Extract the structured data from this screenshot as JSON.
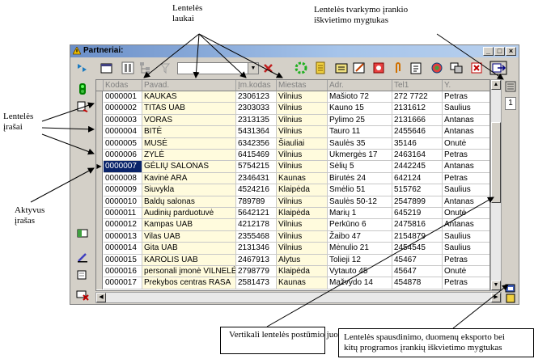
{
  "window": {
    "title": "Partneriai:",
    "min": "_",
    "max": "□",
    "close": "×"
  },
  "toolbar": {
    "combo_value": ""
  },
  "grid": {
    "columns": [
      "Kodas",
      "Pavad.",
      "Įm.kodas",
      "Miestas",
      "Adr.",
      "Tel1",
      "Y."
    ],
    "rows": [
      [
        "0000001",
        "KAUKAS",
        "2306123",
        "Vilnius",
        "Mašioto 72",
        "272 7722",
        "Petras"
      ],
      [
        "0000002",
        "TITAS UAB",
        "2303033",
        "Vilnius",
        "Kauno 15",
        "2131612",
        "Saulius"
      ],
      [
        "0000003",
        "VORAS",
        "2313135",
        "Vilnius",
        "Pylimo 25",
        "2131666",
        "Antanas"
      ],
      [
        "0000004",
        "BITĖ",
        "5431364",
        "Vilnius",
        "Tauro 11",
        "2455646",
        "Antanas"
      ],
      [
        "0000005",
        "MUSĖ",
        "6342356",
        "Šiauliai",
        "Saulės 35",
        "35146",
        "Onutė"
      ],
      [
        "0000006",
        "ZYLĖ",
        "6415469",
        "Vilnius",
        "Ukmergės 17",
        "2463164",
        "Petras"
      ],
      [
        "0000007",
        "GĖLIŲ SALONAS",
        "5754215",
        "Vilnius",
        "Sėlių 5",
        "2442245",
        "Antanas"
      ],
      [
        "0000008",
        "Kavinė ARA",
        "2346431",
        "Kaunas",
        "Birutės 24",
        "642124",
        "Petras"
      ],
      [
        "0000009",
        "Siuvykla",
        "4524216",
        "Klaipėda",
        "Smėlio 51",
        "515762",
        "Saulius"
      ],
      [
        "0000010",
        "Baldų salonas",
        "789789",
        "Vilnius",
        "Saulės 50-12",
        "2547899",
        "Antanas"
      ],
      [
        "0000011",
        "Audinių parduotuvė",
        "5642121",
        "Klaipėda",
        "Marių 1",
        "645219",
        "Onutė"
      ],
      [
        "0000012",
        "Kampas UAB",
        "4212178",
        "Vilnius",
        "Perkūno 6",
        "2475816",
        "Antanas"
      ],
      [
        "0000013",
        "Vilas UAB",
        "2355468",
        "Vilnius",
        "Žaibo 47",
        "2154879",
        "Saulius"
      ],
      [
        "0000014",
        "Gita UAB",
        "2131346",
        "Vilnius",
        "Mėnulio 21",
        "2454545",
        "Saulius"
      ],
      [
        "0000015",
        "KAROLIS UAB",
        "2467913",
        "Alytus",
        "Tolieji 12",
        "45467",
        "Petras"
      ],
      [
        "0000016",
        "personali įmonė VILNELĖ",
        "2798779",
        "Klaipėda",
        "Vytauto 45",
        "45647",
        "Onutė"
      ],
      [
        "0000017",
        "Prekybos centras RASA",
        "2581473",
        "Kaunas",
        "Mažvydo 14",
        "454878",
        "Petras"
      ]
    ],
    "active_row_index": 6
  },
  "right_panel": {
    "page": "1"
  },
  "annotations": {
    "fields": "Lentelės\nlaukai",
    "manager": "Lentelės tvarkymo įrankio\niškvietimo mygtukas",
    "records": "Lentelės\nįrašai",
    "active": "Aktyvus\nįrašas",
    "vscroll": "Vertikali lentelės\npostūmio juosta",
    "print": "Lentelės spausdinimo, duomenų eksporto bei\nkitų programos įrankių iškvietimo mygtukas"
  },
  "colors": {
    "title_gradient_start": "#6b8fc8",
    "selection": "#0a246a",
    "highlight_column": "#fffbdd"
  }
}
